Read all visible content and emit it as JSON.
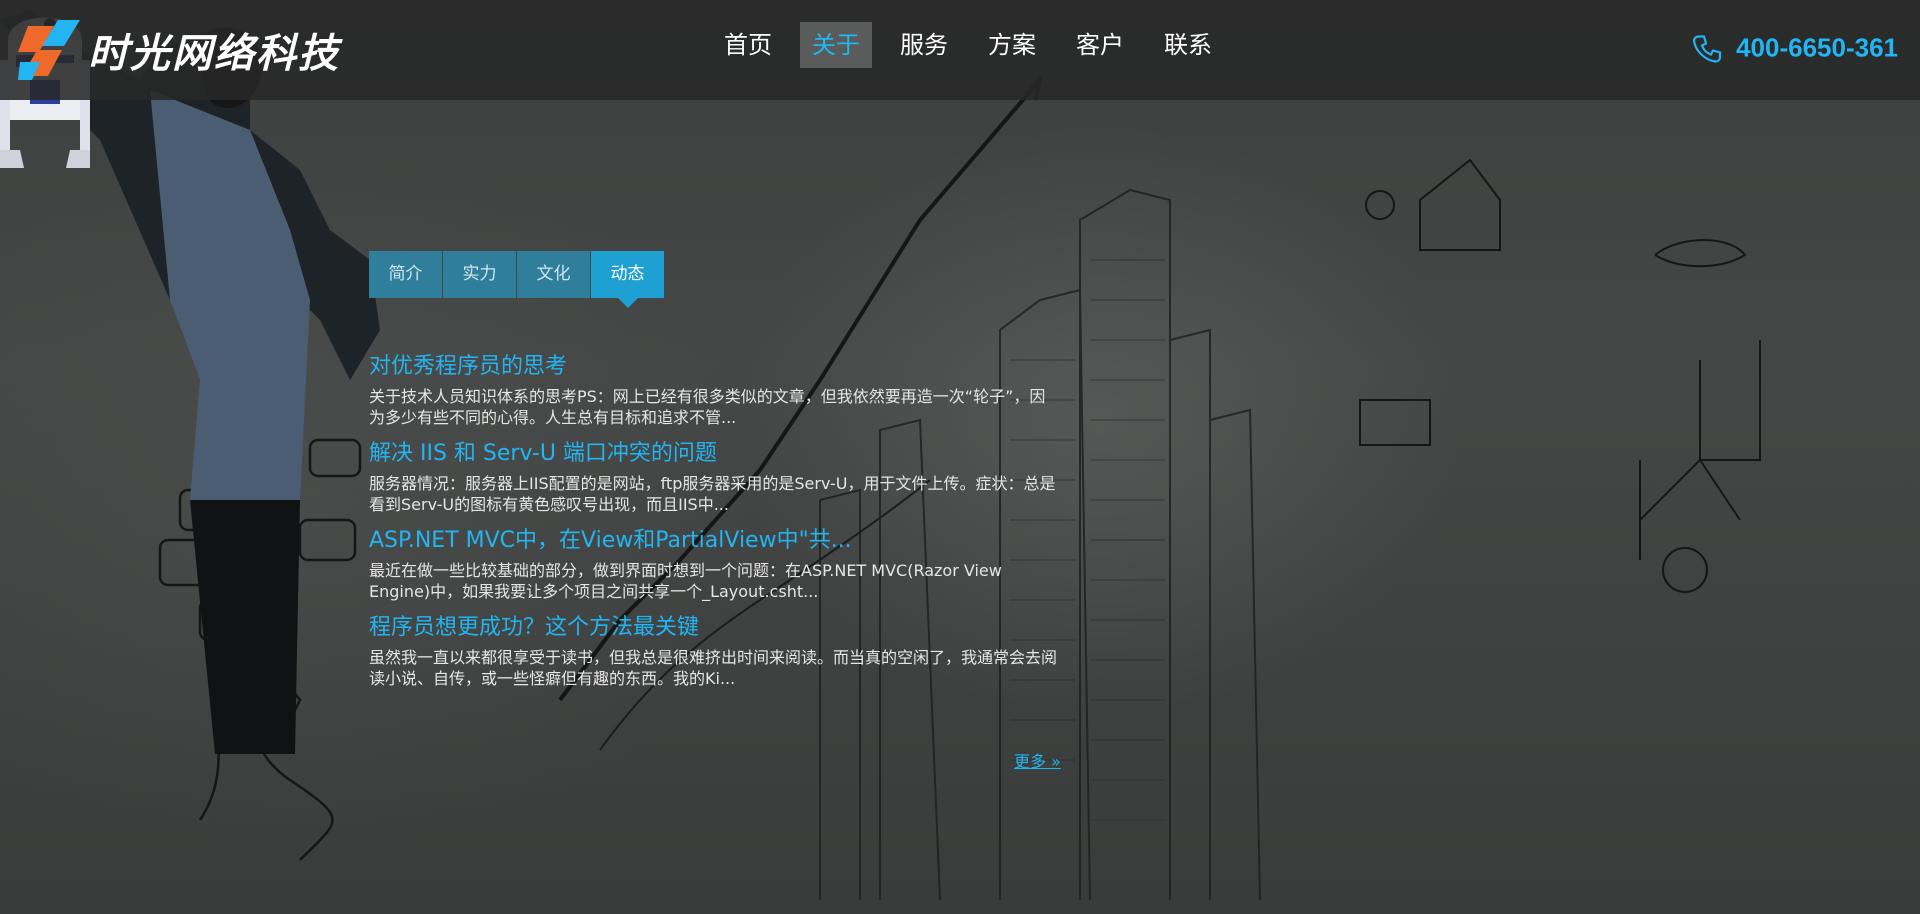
{
  "brand": {
    "name": "时光网络科技",
    "accent": "#22b5f2",
    "logo_orange": "#ef6a2a",
    "logo_blue": "#22b5f2"
  },
  "nav": {
    "items": [
      {
        "label": "首页"
      },
      {
        "label": "关于",
        "active": true
      },
      {
        "label": "服务"
      },
      {
        "label": "方案"
      },
      {
        "label": "客户"
      },
      {
        "label": "联系"
      }
    ]
  },
  "contact": {
    "phone": "400-6650-361",
    "icon": "phone-icon"
  },
  "tabs": [
    {
      "label": "简介"
    },
    {
      "label": "实力"
    },
    {
      "label": "文化"
    },
    {
      "label": "动态",
      "active": true
    }
  ],
  "articles": [
    {
      "title": "对优秀程序员的思考",
      "summary": "关于技术人员知识体系的思考PS：网上已经有很多类似的文章，但我依然要再造一次“轮子”，因为多少有些不同的心得。人生总有目标和追求不管..."
    },
    {
      "title": "解决 IIS 和 Serv-U 端口冲突的问题",
      "summary": "服务器情况：服务器上IIS配置的是网站，ftp服务器采用的是Serv-U，用于文件上传。症状：总是看到Serv-U的图标有黄色感叹号出现，而且IIS中..."
    },
    {
      "title": "ASP.NET MVC中，在View和PartialView中\"共...",
      "summary": "最近在做一些比较基础的部分，做到界面时想到一个问题：在ASP.NET MVC(Razor View Engine)中，如果我要让多个项目之间共享一个_Layout.csht..."
    },
    {
      "title": "程序员想更成功？这个方法最关键",
      "summary": "虽然我一直以来都很享受于读书，但我总是很难挤出时间来阅读。而当真的空闲了，我通常会去阅读小说、自传，或一些怪癖但有趣的东西。我的Ki..."
    }
  ],
  "more": {
    "label": "更多 »"
  }
}
